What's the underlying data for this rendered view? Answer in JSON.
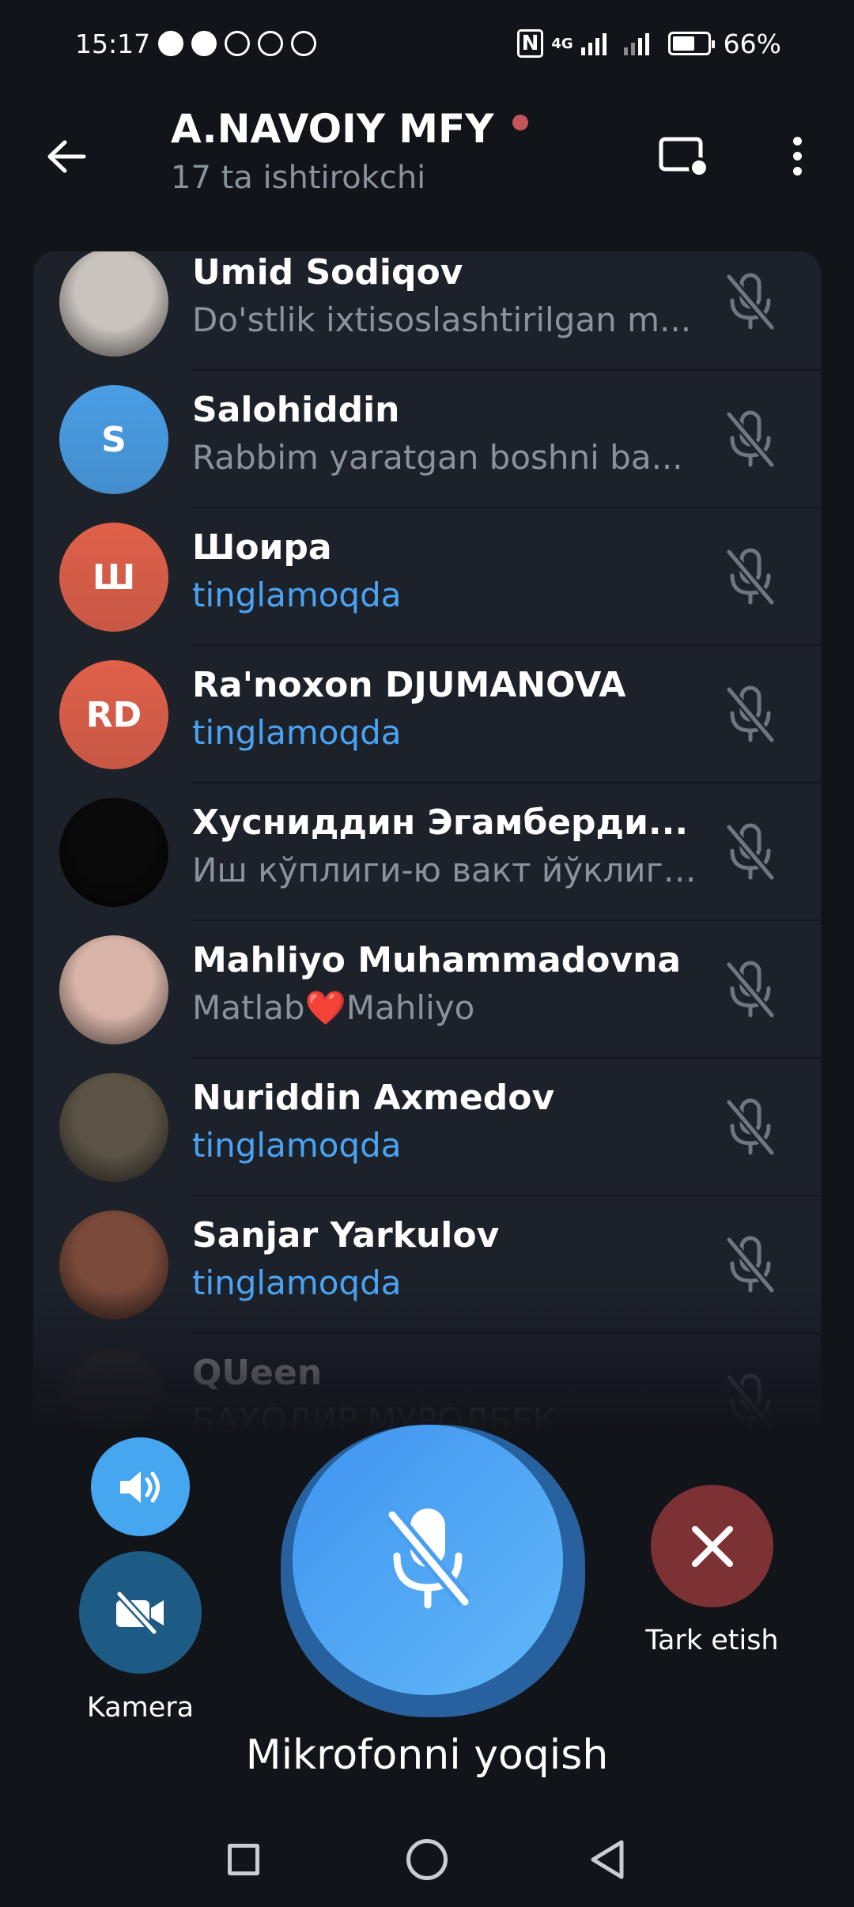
{
  "status_bar": {
    "time": "15:17",
    "network": "4G",
    "battery": "66%",
    "battery_fraction": 0.66
  },
  "header": {
    "title": "A.NAVOIY MFY",
    "subtitle": "17 ta ishtirokchi"
  },
  "participants": [
    {
      "name": "Umid Sodiqov",
      "status": "Do'stlik ixtisoslashtirilgan m...",
      "listening": false,
      "avatar": {
        "type": "photo",
        "color": "#c9c3bd"
      }
    },
    {
      "name": "Salohiddin",
      "status": "Rabbim yaratgan boshni ba...",
      "listening": false,
      "avatar": {
        "type": "initials",
        "text": "S",
        "color": "#4a9ee6"
      }
    },
    {
      "name": "Шоира",
      "status": "tinglamoqda",
      "listening": true,
      "avatar": {
        "type": "initials",
        "text": "Ш",
        "color": "#e06049"
      }
    },
    {
      "name": "Ra'noxon DJUMANOVA",
      "status": "tinglamoqda",
      "listening": true,
      "avatar": {
        "type": "initials",
        "text": "RD",
        "color": "#e06049"
      }
    },
    {
      "name": "Хусниддин Эгамберди...",
      "status": "Иш кўплиги-ю вакт йўклиги...",
      "listening": false,
      "avatar": {
        "type": "photo",
        "color": "#0a0a0a"
      }
    },
    {
      "name": "Mahliyo Muhammadovna",
      "status": "Matlab❤️Mahliyo",
      "listening": false,
      "avatar": {
        "type": "photo",
        "color": "#d8b4a8"
      }
    },
    {
      "name": "Nuriddin Axmedov",
      "status": "tinglamoqda",
      "listening": true,
      "avatar": {
        "type": "photo",
        "color": "#5b5446"
      }
    },
    {
      "name": "Sanjar Yarkulov",
      "status": "tinglamoqda",
      "listening": true,
      "avatar": {
        "type": "photo",
        "color": "#7a4a3a"
      }
    },
    {
      "name": "QUeen",
      "status": "БАХОДИР МУРОДБЕК",
      "listening": false,
      "avatar": {
        "type": "photo",
        "color": "#2e2e30"
      }
    }
  ],
  "controls": {
    "camera_label": "Kamera",
    "leave_label": "Tark etish",
    "mic_label": "Mikrofonni yoqish"
  },
  "icons": {
    "back": "arrow-left-icon",
    "screen": "screen-share-icon",
    "more": "more-vertical-icon",
    "muted": "mic-off-icon",
    "speaker": "speaker-icon",
    "camera": "video-off-icon",
    "leave": "close-icon"
  },
  "colors": {
    "accent": "#4aa4f3",
    "background": "#111419",
    "list_bg": "#1d212a",
    "leave": "#7c3135",
    "camera": "#1e5b84",
    "mic": "#4a9ef0",
    "recording": "#c5545a"
  }
}
